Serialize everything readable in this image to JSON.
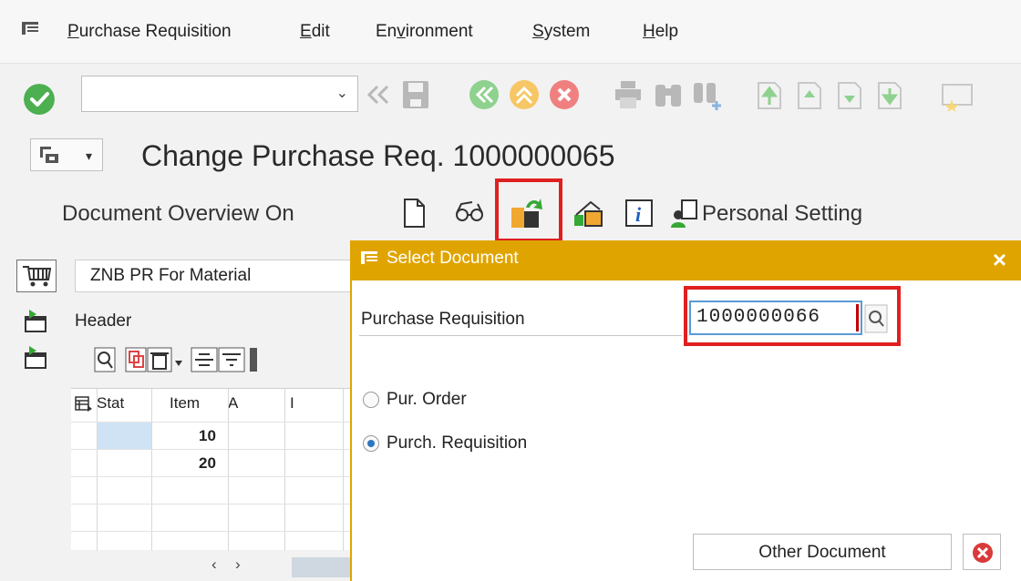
{
  "menu": {
    "items": [
      {
        "mnemonic": "P",
        "rest": "urchase Requisition"
      },
      {
        "mnemonic": "E",
        "rest": "dit"
      },
      {
        "pre": "En",
        "mnemonic": "v",
        "rest": "ironment"
      },
      {
        "mnemonic": "S",
        "rest": "ystem"
      },
      {
        "mnemonic": "H",
        "rest": "elp"
      }
    ]
  },
  "toolbar": {
    "command_field_value": "",
    "icons": [
      "enter-icon",
      "back-double-icon",
      "save-icon",
      "back-icon",
      "exit-icon",
      "cancel-icon",
      "print-icon",
      "find-icon",
      "find-next-icon",
      "first-page-icon",
      "previous-page-icon",
      "next-page-icon",
      "last-page-icon",
      "bookmark-icon"
    ]
  },
  "title": {
    "text": "Change Purchase Req. 1000000065"
  },
  "app_toolbar": {
    "document_overview_label": "Document Overview On",
    "personal_setting_label": "Personal Setting",
    "icons": [
      "create-document-icon",
      "display-change-icon",
      "other-document-icon",
      "hold-icon",
      "info-icon",
      "personal-setting-icon"
    ]
  },
  "left_panel": {
    "document_type": "ZNB PR For Material",
    "header_label": "Header",
    "grid": {
      "columns": [
        "Stat",
        "Item",
        "A",
        "I"
      ],
      "rows": [
        {
          "item": "10"
        },
        {
          "item": "20"
        }
      ]
    },
    "scroll_left": "‹",
    "scroll_right": "›"
  },
  "dialog": {
    "title": "Select Document",
    "close": "×",
    "field_label": "Purchase Requisition",
    "field_value": "1000000066",
    "options": [
      {
        "label": "Pur. Order",
        "selected": false
      },
      {
        "label": "Purch. Requisition",
        "selected": true
      }
    ],
    "other_document_label": "Other Document"
  },
  "colors": {
    "dialog_title_bg": "#e0a400",
    "highlight": "#e02020",
    "enter_green": "#4caf50"
  }
}
